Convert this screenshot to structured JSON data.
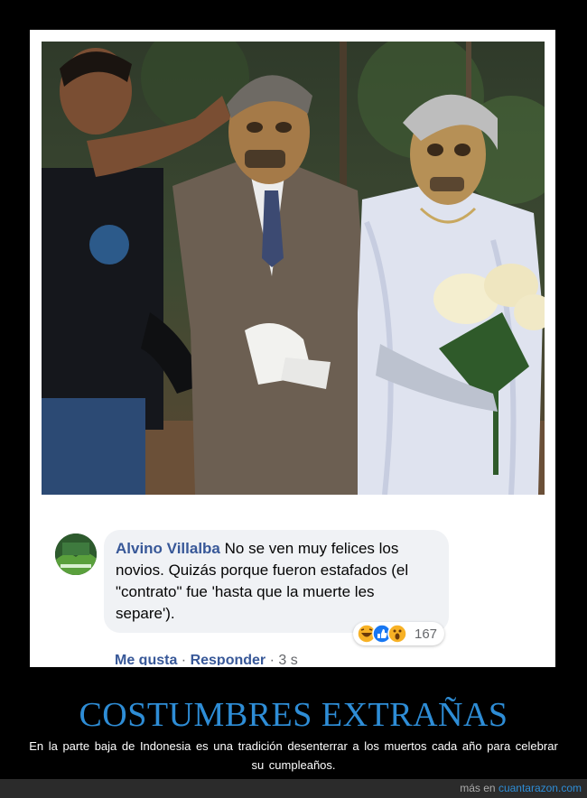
{
  "comment": {
    "author": "Alvino Villalba",
    "text": "No se ven muy felices los novios. Quizás porque fueron estafados (el \"contrato\" fue 'hasta que la muerte les separe').",
    "reaction_count": "167",
    "actions": {
      "like": "Me gusta",
      "separator": "·",
      "reply": "Responder",
      "time": "3 s"
    },
    "reaction_icons": [
      "haha-icon",
      "like-icon",
      "wow-icon"
    ]
  },
  "poster": {
    "title": "COSTUMBRES EXTRAÑAS",
    "caption": "En la parte baja de Indonesia es una tradición desenterrar a los muertos cada año para celebrar su cumpleaños."
  },
  "footer": {
    "prefix": "más en",
    "site": "cuantarazon.com"
  },
  "colors": {
    "title": "#2e8dd6",
    "author": "#385898",
    "background": "#000000"
  }
}
